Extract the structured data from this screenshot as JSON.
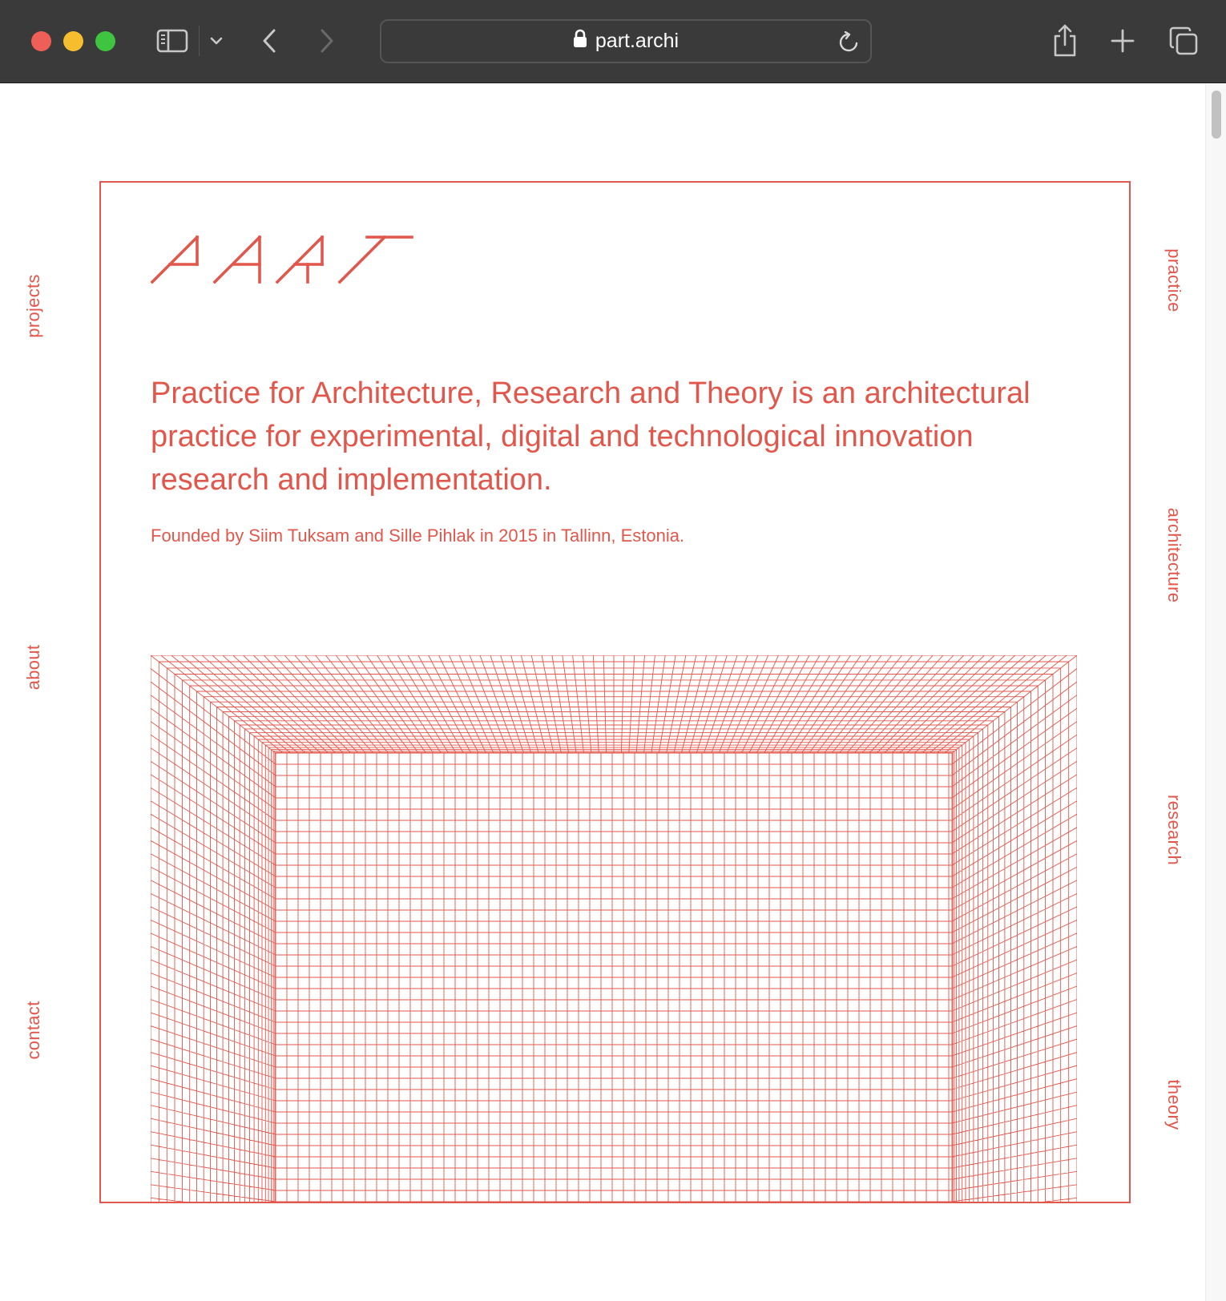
{
  "browser": {
    "url": "part.archi",
    "icons": [
      "sidebar-icon",
      "chevron-down-icon",
      "back-icon",
      "forward-icon",
      "lock-icon",
      "reload-icon",
      "share-icon",
      "new-tab-icon",
      "tabs-overview-icon"
    ]
  },
  "site": {
    "logo_text": "PART",
    "accent_color": "#e2574c",
    "nav_left": [
      {
        "label": "projects"
      },
      {
        "label": "about"
      },
      {
        "label": "contact"
      }
    ],
    "nav_right": [
      {
        "label": "practice"
      },
      {
        "label": "architecture"
      },
      {
        "label": "research"
      },
      {
        "label": "theory"
      }
    ],
    "tagline": "Practice for Architecture, Research and Theory is an architectural practice for experimental, digital and technological innovation research and implementation.",
    "founded": "Founded by Siim Tuksam and Sille Pihlak in 2015 in Tallinn, Estonia."
  }
}
